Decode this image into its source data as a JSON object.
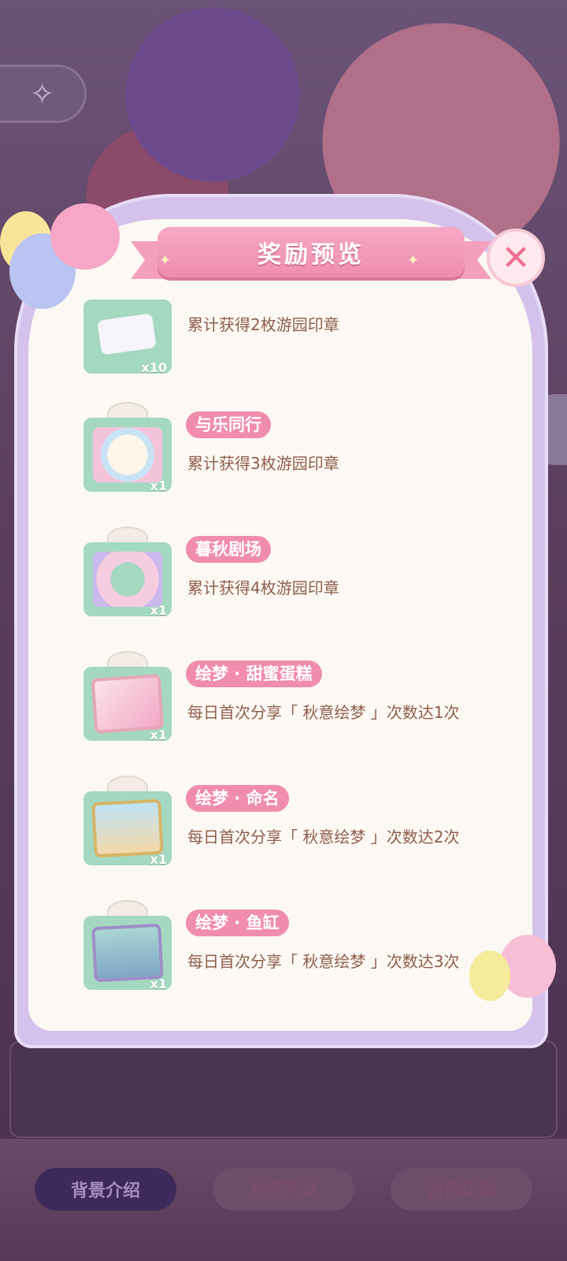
{
  "modal": {
    "title": "奖励预览",
    "close_icon": "close-icon"
  },
  "rewards": [
    {
      "name": "",
      "quantity": "x10",
      "description": "累计获得2枚游园印章"
    },
    {
      "name": "与乐同行",
      "quantity": "x1",
      "description": "累计获得3枚游园印章"
    },
    {
      "name": "暮秋剧场",
      "quantity": "x1",
      "description": "累计获得4枚游园印章"
    },
    {
      "name": "绘梦 · 甜蜜蛋糕",
      "quantity": "x1",
      "description": "每日首次分享「 秋意绘梦 」次数达1次"
    },
    {
      "name": "绘梦 · 命名",
      "quantity": "x1",
      "description": "每日首次分享「 秋意绘梦 」次数达2次"
    },
    {
      "name": "绘梦 · 鱼缸",
      "quantity": "x1",
      "description": "每日首次分享「 秋意绘梦 」次数达3次"
    }
  ],
  "bottom_nav": {
    "tabs": [
      "背景介绍",
      "游园活动",
      "游园印章"
    ]
  },
  "colors": {
    "accent_pink": "#f08cae",
    "gift_green": "#a5d8c1",
    "desc_brown": "#8f5e4e",
    "modal_purple": "#d4c2ec"
  }
}
